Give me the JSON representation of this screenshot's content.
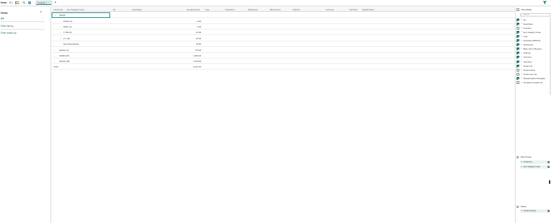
{
  "topbar": {
    "items_label": "Items:",
    "filter_value": "All",
    "tab_label": "Analysis 1",
    "tab_close": "×",
    "add_tab": "+"
  },
  "views": {
    "title": "Views",
    "all_label": "All",
    "filter_list_by": "Filter list by...",
    "filter_totals_by": "Filter totals by..."
  },
  "grid": {
    "headers": [
      "Vendor No.",
      "Item Category Code",
      "No.",
      "Description",
      "Sum(Inventory)",
      "Type",
      "Production...",
      "Routing No.",
      "Base Unit of...",
      "Tariff No.",
      "Unit Cost",
      "Unit Price",
      "Default Deferr..."
    ],
    "rows": [
      {
        "toggle": "⌄",
        "label": "(blank)",
        "value": ""
      },
      {
        "toggle": "›",
        "label": "PAINT (1)",
        "value": "-4.00"
      },
      {
        "toggle": "›",
        "label": "MISC (1)",
        "value": "2.00"
      },
      {
        "toggle": "›",
        "label": "TYPE (3)",
        "value": "61.00"
      },
      {
        "toggle": "›",
        "label": "(7 / 42)",
        "value": "10.00"
      },
      {
        "toggle": "",
        "label": "Sub Total (blank)",
        "value": "70.00"
      },
      {
        "toggle": "›",
        "label": "(blank) (4)",
        "value": "774.00"
      },
      {
        "toggle": "›",
        "label": "10000 (25)",
        "value": "1,364.00"
      },
      {
        "toggle": "›",
        "label": "(blank) (29)",
        "value": "1,164.00"
      },
      {
        "toggle": "",
        "label": "Total",
        "value": "4,227.00"
      }
    ]
  },
  "pivot": {
    "mode_label": "Pivot Mode",
    "search_placeholder": "Search...",
    "columns": [
      {
        "name": "No.",
        "checked": true
      },
      {
        "name": "Description",
        "checked": true
      },
      {
        "name": "Inventory",
        "checked": false
      },
      {
        "name": "Item Category Code",
        "checked": true
      },
      {
        "name": "Type",
        "checked": true
      },
      {
        "name": "Production BOM No.",
        "checked": true
      },
      {
        "name": "Routing No.",
        "checked": true
      },
      {
        "name": "Base Unit of Measure",
        "checked": true
      },
      {
        "name": "Tariff No.",
        "checked": true
      },
      {
        "name": "Unit Cost",
        "checked": true
      },
      {
        "name": "Unit Price",
        "checked": true
      },
      {
        "name": "Vendor No.",
        "checked": true
      },
      {
        "name": "Vendor Name",
        "checked": false
      },
      {
        "name": "Vendor Item No.",
        "checked": false
      },
      {
        "name": "Default Deferral Template",
        "checked": true
      },
      {
        "name": "Occupancy System ID",
        "checked": false
      }
    ],
    "row_groups_label": "Row Groups",
    "row_groups": [
      "Vendor No.",
      "Item Category Code"
    ],
    "values_label": "Values",
    "values": [
      "Sum(Inventory)"
    ]
  },
  "colors": {
    "accent": "#1a6f6a",
    "header_bg": "#f7f7f7"
  }
}
